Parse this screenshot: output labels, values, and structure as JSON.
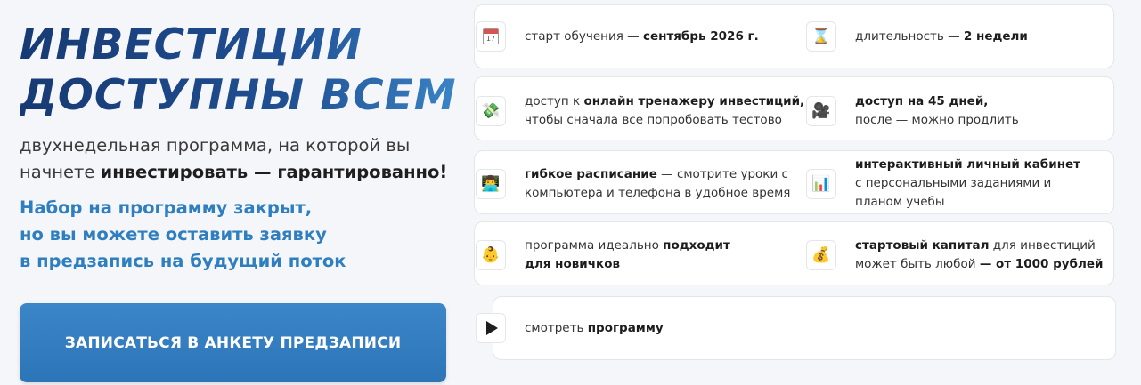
{
  "headline": {
    "line1": "ИНВЕСТИЦИИ",
    "line2": "ДОСТУПНЫ ВСЕМ"
  },
  "subtitle": {
    "part1": "двухнедельная программа, на которой вы начнете ",
    "bold": "инвестировать — гарантированно!"
  },
  "notice": {
    "line1": "Набор на программу закрыт,",
    "line2": "но вы можете оставить заявку",
    "line3": "в предзапись на будущий поток"
  },
  "cta": {
    "label": "ЗАПИСАТЬСЯ В АНКЕТУ ПРЕДЗАПИСИ"
  },
  "features": {
    "start": {
      "icon": "calendar-icon",
      "cal_day": "17",
      "pre": "старт обучения — ",
      "bold": "сентябрь 2026 г."
    },
    "duration": {
      "icon": "hourglass-icon",
      "glyph": "⌛",
      "pre": "длительность — ",
      "bold": "2 недели"
    },
    "simulator": {
      "icon": "money-icon",
      "glyph": "💸",
      "pre": "доступ к ",
      "bold": "онлайн тренажеру инвестиций,",
      "line2": "чтобы сначала все попробовать тестово"
    },
    "access": {
      "icon": "video-camera-icon",
      "glyph": "🎥",
      "bold": "доступ на 45 дней,",
      "line2": "после — можно продлить"
    },
    "schedule": {
      "icon": "laptop-user-icon",
      "glyph": "👨‍💻",
      "bold": "гибкое расписание",
      "post": " — смотрите уроки с",
      "line2": "компьютера и телефона в удобное время"
    },
    "cabinet": {
      "icon": "bar-chart-icon",
      "glyph": "📊",
      "bold": "интерактивный личный кабинет",
      "line2": "с персональными заданиями и",
      "line3": "планом учебы"
    },
    "beginners": {
      "icon": "baby-face-icon",
      "glyph": "👶",
      "pre": "программа идеально ",
      "bold": "подходит",
      "line2": "для новичков"
    },
    "capital": {
      "icon": "money-bag-icon",
      "glyph": "💰",
      "bold": "стартовый капитал",
      "post": " для инвестиций",
      "line2_pre": "может быть любой ",
      "line2_bold": "— от 1000 рублей"
    },
    "program": {
      "icon": "play-icon",
      "pre": "смотреть ",
      "bold": "программу"
    }
  }
}
